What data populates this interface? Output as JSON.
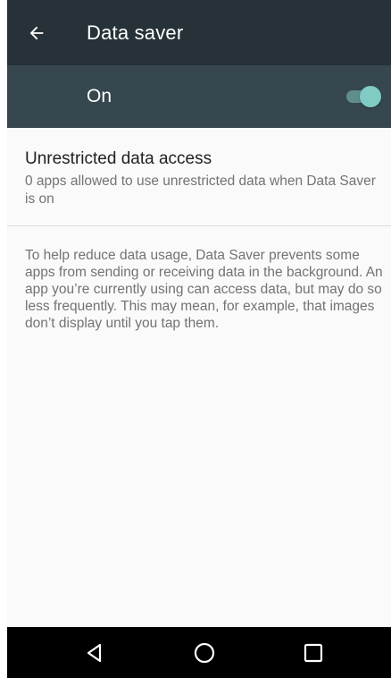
{
  "toolbar": {
    "title": "Data saver",
    "back_icon": "arrow-back-icon"
  },
  "master_switch": {
    "label": "On",
    "checked": true,
    "accent_color": "#80cbc4"
  },
  "unrestricted": {
    "title": "Unrestricted data access",
    "summary": "0 apps allowed to use unrestricted data when Data Saver is on"
  },
  "footer": {
    "text": "To help reduce data usage, Data Saver prevents some apps from sending or receiving data in the background. An app you’re currently using can access data, but may do so less frequently. This may mean, for example, that images don’t display until you tap them."
  },
  "navbar": {
    "back_icon": "nav-back-icon",
    "home_icon": "nav-home-icon",
    "recents_icon": "nav-recents-icon"
  },
  "colors": {
    "toolbar": "#263238",
    "switch_bar": "#37474f",
    "background": "#fafafa",
    "navbar": "#000000"
  }
}
